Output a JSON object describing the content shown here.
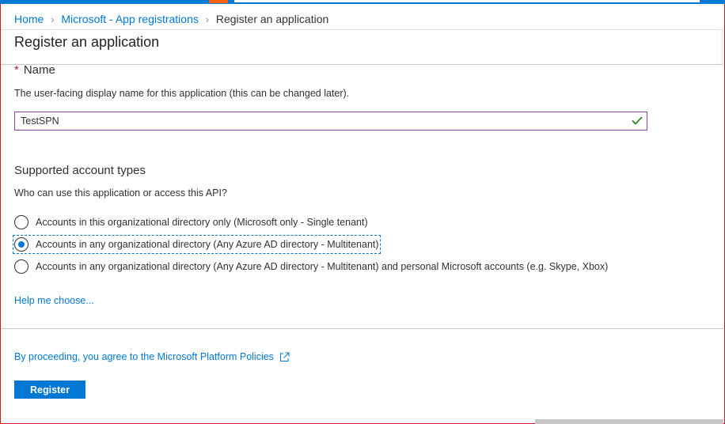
{
  "breadcrumb": {
    "items": [
      "Home",
      "Microsoft - App registrations",
      "Register an application"
    ]
  },
  "page": {
    "title": "Register an application"
  },
  "name_section": {
    "required_mark": "*",
    "label": "Name",
    "description": "The user-facing display name for this application (this can be changed later).",
    "input_value": "TestSPN",
    "valid_icon": "checkmark-icon"
  },
  "account_types": {
    "heading": "Supported account types",
    "question": "Who can use this application or access this API?",
    "options": [
      {
        "label": "Accounts in this organizational directory only (Microsoft only - Single tenant)",
        "selected": false
      },
      {
        "label": "Accounts in any organizational directory (Any Azure AD directory - Multitenant)",
        "selected": true
      },
      {
        "label": "Accounts in any organizational directory (Any Azure AD directory - Multitenant) and personal Microsoft accounts (e.g. Skype, Xbox)",
        "selected": false
      }
    ],
    "help_link": "Help me choose..."
  },
  "footer": {
    "policy_text": "By proceeding, you agree to the Microsoft Platform Policies",
    "policy_icon": "external-link-icon",
    "register_label": "Register"
  },
  "colors": {
    "accent": "#0078d4",
    "link": "#0078d4",
    "required": "#a4262c",
    "input_border_focus": "#8a3ea8",
    "valid_check": "#107c10"
  }
}
